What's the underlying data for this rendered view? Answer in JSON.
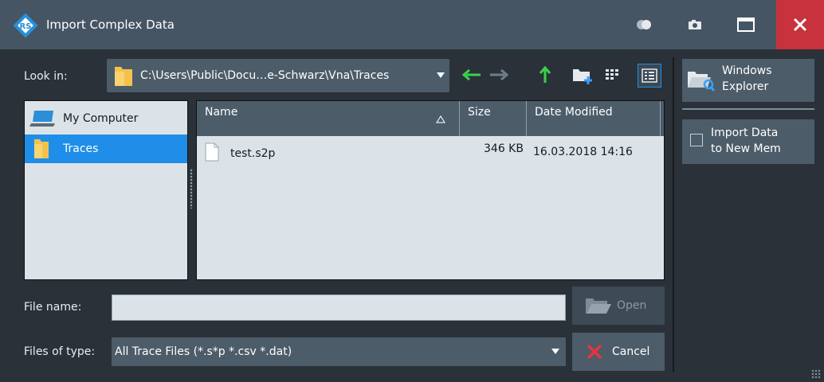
{
  "window": {
    "title": "Import Complex Data"
  },
  "toolbar": {
    "look_in_label": "Look in:",
    "path": "C:\\Users\\Public\\Docu…e-Schwarz\\Vna\\Traces"
  },
  "places": [
    {
      "label": "My Computer",
      "selected": false
    },
    {
      "label": "Traces",
      "selected": true
    }
  ],
  "file_table": {
    "columns": [
      "Name",
      "Size",
      "Date Modified"
    ],
    "rows": [
      {
        "name": "test.s2p",
        "size": "346 KB",
        "date": "16.03.2018 14:16"
      }
    ]
  },
  "form": {
    "file_name_label": "File name:",
    "file_name_value": "",
    "files_of_type_label": "Files of type:",
    "files_of_type_value": "All Trace Files (*.s*p *.csv *.dat)"
  },
  "buttons": {
    "open": "Open",
    "cancel": "Cancel"
  },
  "sidebar": {
    "explorer_line1": "Windows",
    "explorer_line2": "Explorer",
    "import_line1": "Import Data",
    "import_line2": "to New Mem",
    "import_checked": false
  },
  "colors": {
    "titlebar": "#455564",
    "close": "#c8323c",
    "selection": "#1f8ee8",
    "nav_green": "#39d14a"
  }
}
